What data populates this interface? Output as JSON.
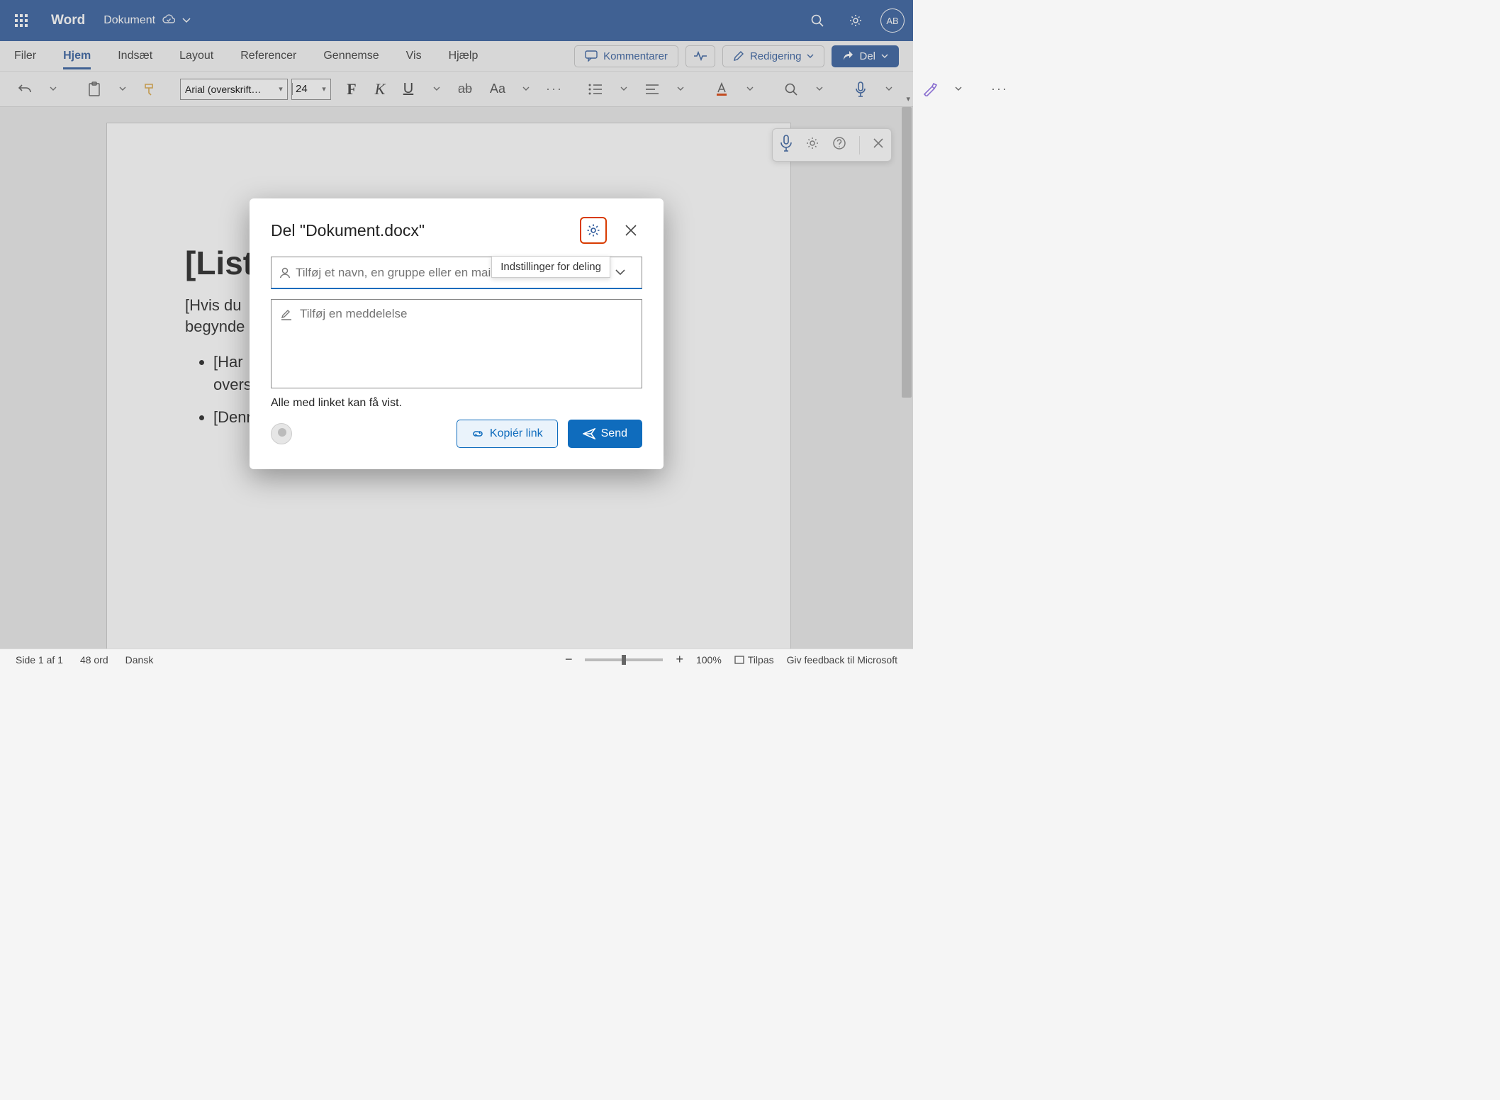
{
  "header": {
    "app_name": "Word",
    "doc_name": "Dokument",
    "avatar_initials": "AB"
  },
  "menus": {
    "items": [
      "Filer",
      "Hjem",
      "Indsæt",
      "Layout",
      "Referencer",
      "Gennemse",
      "Vis",
      "Hjælp"
    ],
    "active_index": 1,
    "comments_label": "Kommentarer",
    "editing_label": "Redigering",
    "share_label": "Del"
  },
  "ribbon": {
    "font_name": "Arial (overskrift…",
    "font_size": "24",
    "change_case": "Aa"
  },
  "document": {
    "title": "[Liste",
    "para1": "[Hvis du",
    "para1_cont": "og begynde",
    "bullet1a": "[Har",
    "bullet1b": "overs",
    "bullet2": "[Denn"
  },
  "modal": {
    "title": "Del \"Dokument.docx\"",
    "tooltip": "Indstillinger for deling",
    "recipient_placeholder": "Tilføj et navn, en gruppe eller en mai",
    "message_placeholder": "Tilføj en meddelelse",
    "permission_text": "Alle med linket kan få vist.",
    "copy_label": "Kopiér link",
    "send_label": "Send"
  },
  "status": {
    "page": "Side 1 af 1",
    "words": "48 ord",
    "language": "Dansk",
    "zoom": "100%",
    "fit": "Tilpas",
    "feedback": "Giv feedback til Microsoft"
  }
}
